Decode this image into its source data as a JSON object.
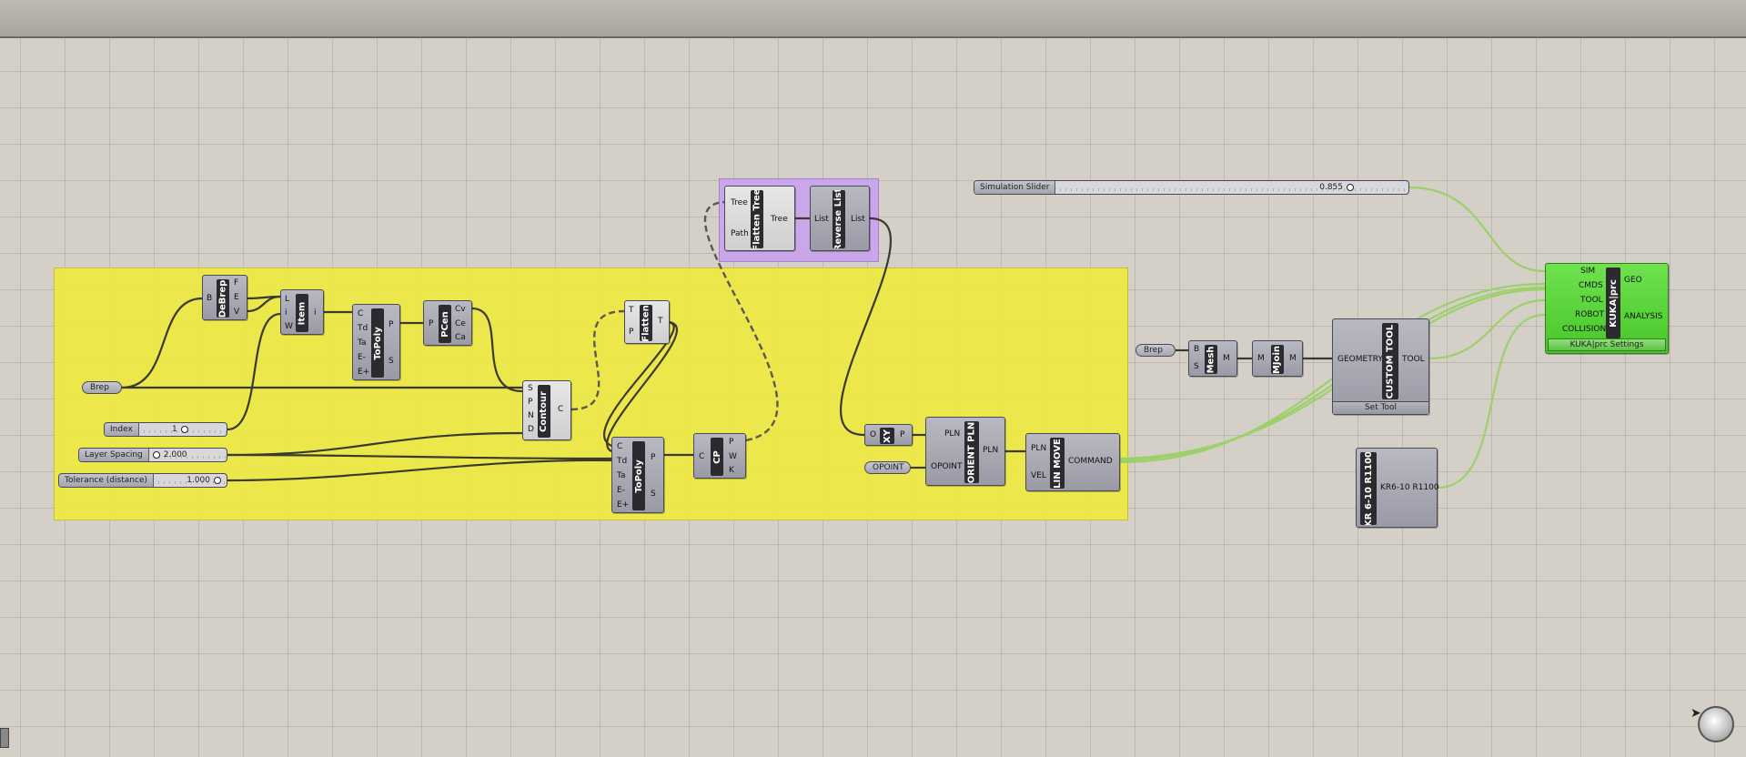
{
  "canvas": {
    "groups": [
      {
        "id": "yellow-group",
        "color": "#eee840"
      },
      {
        "id": "purple-group",
        "color": "#c8a0f0"
      }
    ]
  },
  "components": {
    "debrep": {
      "name": "DeBrep",
      "inputs": [
        "B"
      ],
      "outputs": [
        "F",
        "E",
        "V"
      ]
    },
    "item": {
      "name": "Item",
      "inputs": [
        "L",
        "i",
        "W"
      ],
      "outputs": [
        "i"
      ]
    },
    "topoly1": {
      "name": "ToPoly",
      "inputs": [
        "C",
        "Td",
        "Ta",
        "E-",
        "E+"
      ],
      "outputs": [
        "P",
        "S"
      ]
    },
    "pcen": {
      "name": "PCen",
      "inputs": [
        "P"
      ],
      "outputs": [
        "Cv",
        "Ce",
        "Ca"
      ]
    },
    "contour": {
      "name": "Contour",
      "inputs": [
        "S",
        "P",
        "N",
        "D"
      ],
      "outputs": [
        "C"
      ]
    },
    "flatten": {
      "name": "Flatten",
      "inputs": [
        "T",
        "P"
      ],
      "outputs": [
        "T"
      ]
    },
    "topoly2": {
      "name": "ToPoly",
      "inputs": [
        "C",
        "Td",
        "Ta",
        "E-",
        "E+"
      ],
      "outputs": [
        "P",
        "S"
      ]
    },
    "cp": {
      "name": "CP",
      "inputs": [
        "C"
      ],
      "outputs": [
        "P",
        "W",
        "K"
      ]
    },
    "flatten_tree": {
      "name": "Flatten Tree",
      "inputs": [
        "Tree",
        "Path"
      ],
      "outputs": [
        "Tree"
      ]
    },
    "reverse_list": {
      "name": "Reverse List",
      "inputs": [
        "List"
      ],
      "outputs": [
        "List"
      ]
    },
    "xy": {
      "name": "XY",
      "inputs": [
        "O"
      ],
      "outputs": [
        "P"
      ]
    },
    "orient_pln": {
      "name": "ORIENT PLN",
      "inputs": [
        "PLN",
        "OPOINT"
      ],
      "outputs": [
        "PLN"
      ]
    },
    "lin_move": {
      "name": "LIN MOVE",
      "inputs": [
        "PLN",
        "VEL"
      ],
      "outputs": [
        "COMMAND"
      ]
    },
    "mesh": {
      "name": "Mesh",
      "inputs": [
        "B",
        "S"
      ],
      "outputs": [
        "M"
      ]
    },
    "mjoin": {
      "name": "MJoin",
      "inputs": [
        "M"
      ],
      "outputs": [
        "M"
      ]
    },
    "custom_tool": {
      "name": "CUSTOM TOOL",
      "inputs": [
        "GEOMETRY"
      ],
      "outputs": [
        "TOOL"
      ],
      "footer": "Set Tool"
    },
    "kuka_prc": {
      "name": "KUKA|prc",
      "inputs": [
        "SIM",
        "CMDS",
        "TOOL",
        "ROBOT",
        "COLLISION"
      ],
      "outputs": [
        "GEO",
        "ANALYSIS"
      ],
      "footer": "KUKA|prc Settings"
    },
    "robot": {
      "name": "KR 6-10 R1100",
      "outputs": [
        "KR6-10 R1100"
      ]
    }
  },
  "params": {
    "brep1": "Brep",
    "brep2": "Brep",
    "opoint": "OPOINT"
  },
  "sliders": {
    "index": {
      "label": "Index",
      "value": "1"
    },
    "layer_spacing": {
      "label": "Layer Spacing",
      "value": "2.000"
    },
    "tolerance": {
      "label": "Tolerance (distance)",
      "value": "1.000"
    },
    "simulation": {
      "label": "Simulation Slider",
      "value": "0.855"
    }
  },
  "colors": {
    "wire": "#3b3a30",
    "wire_selected": "#9cd06a",
    "canvas": "#d4d0c8"
  }
}
